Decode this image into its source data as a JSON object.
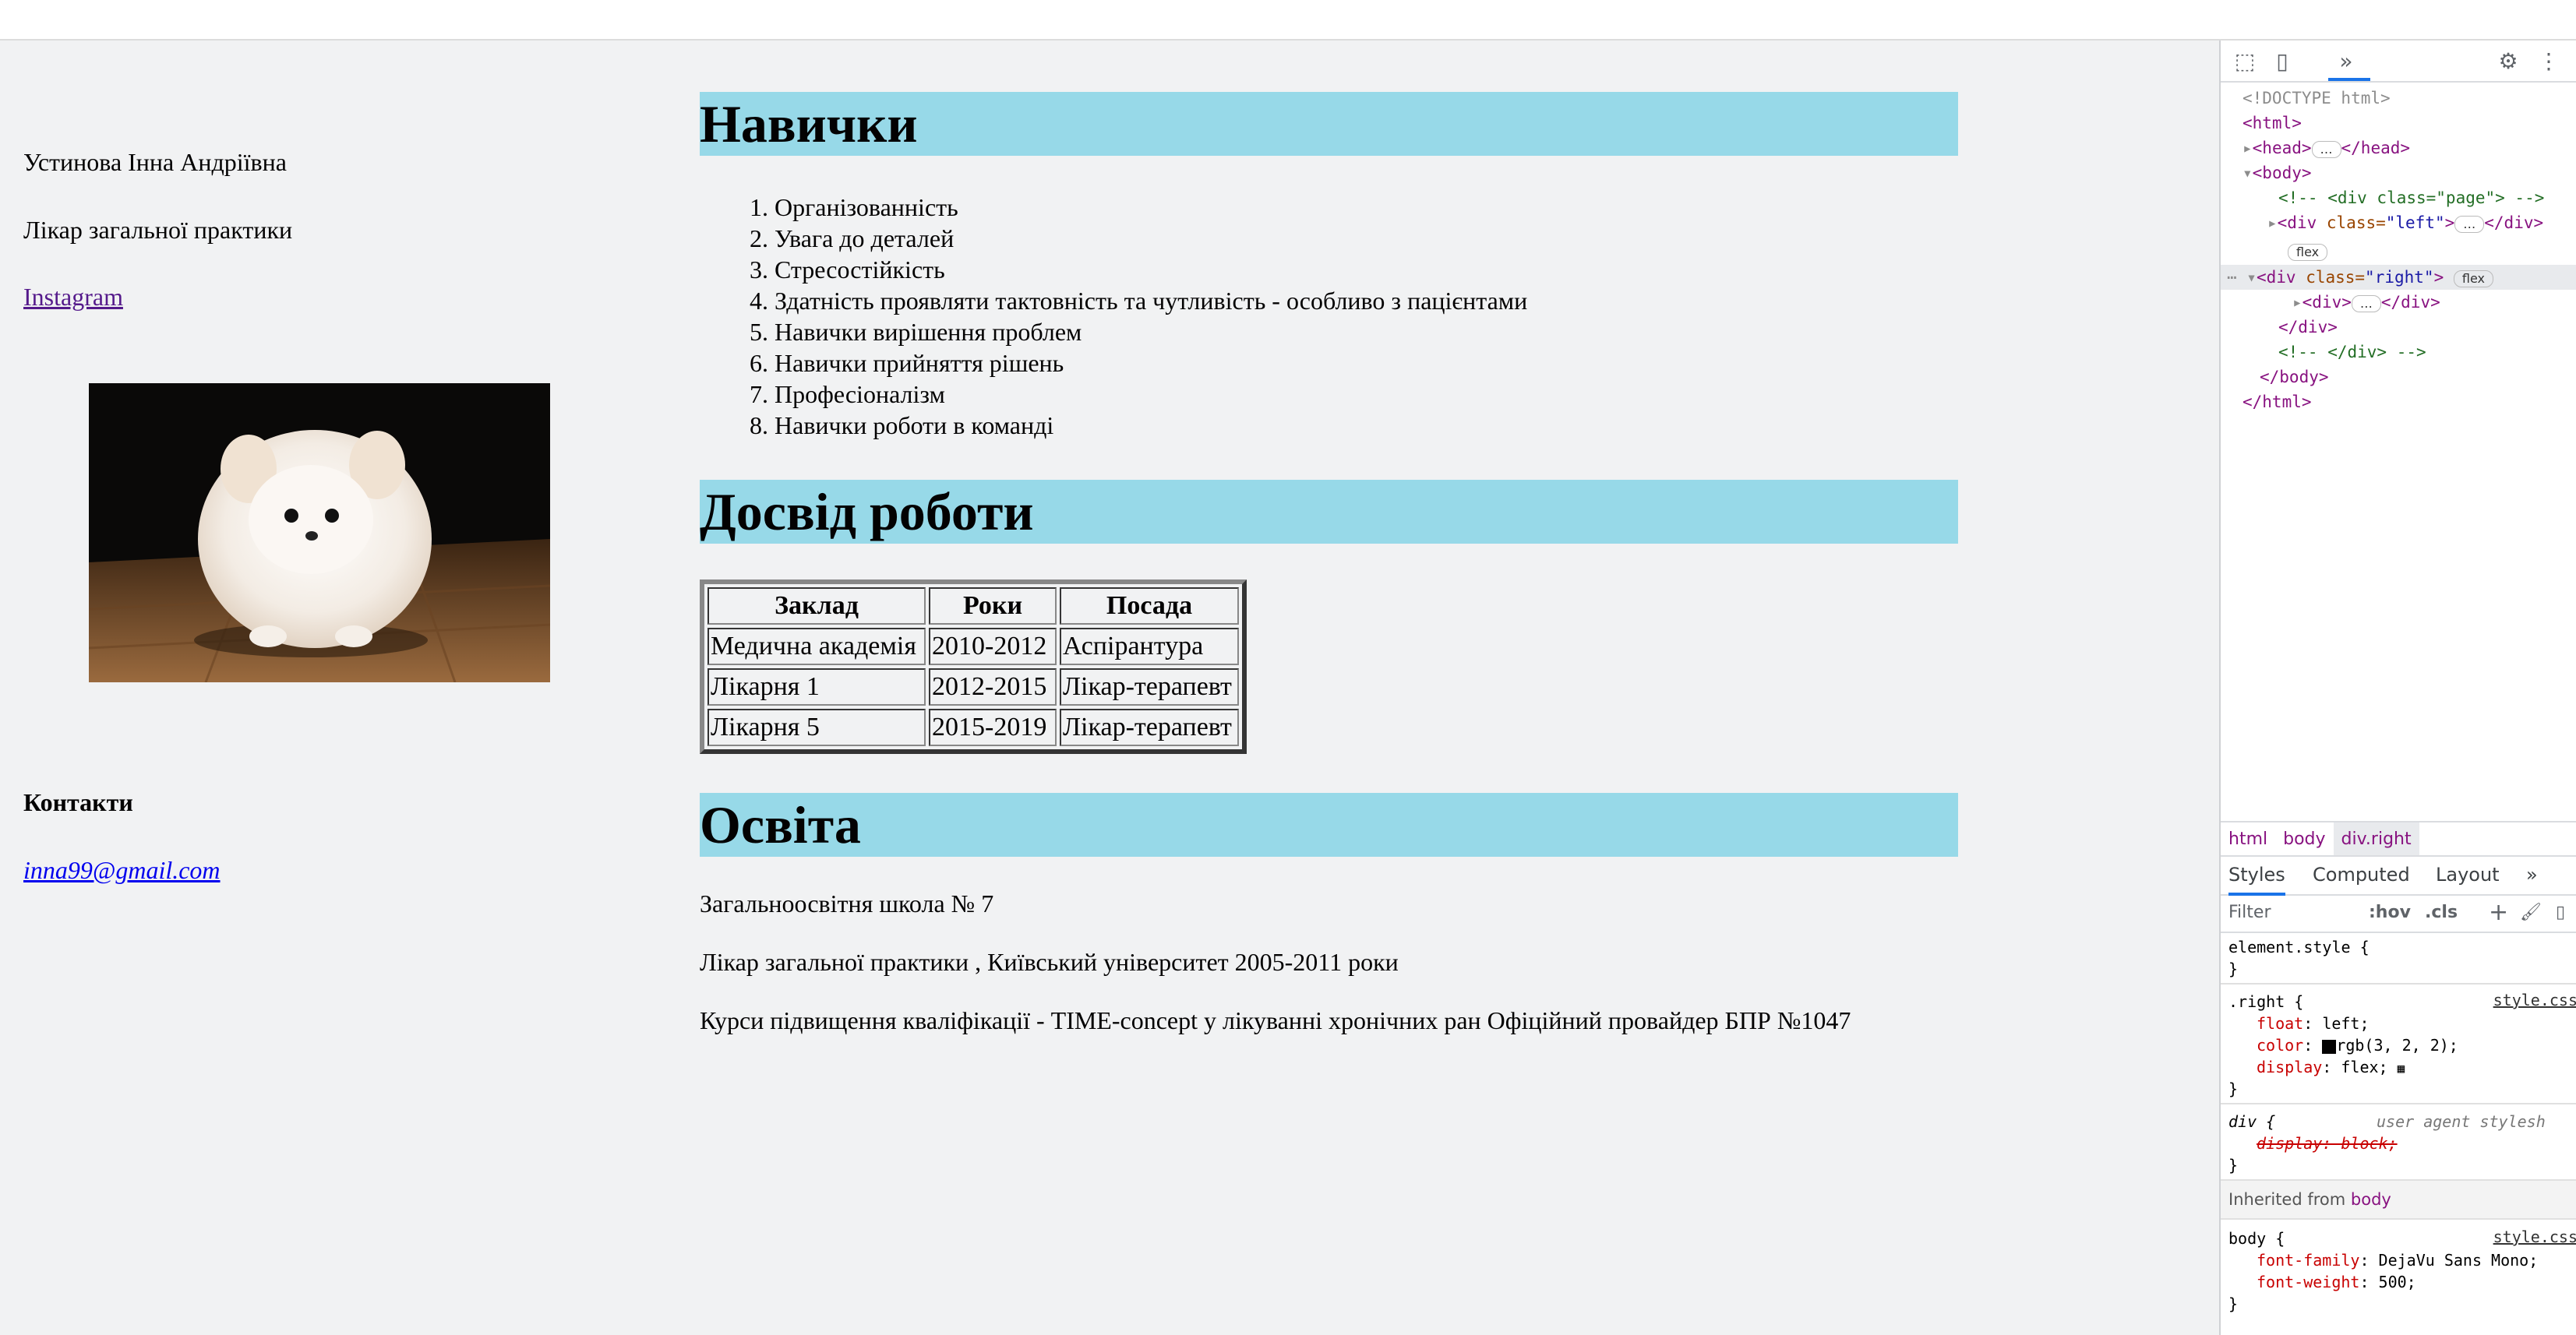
{
  "left": {
    "name": "Устинова Інна Андріївна",
    "role": "Лікар загальної практики",
    "instagram": "Instagram",
    "photo_alt": "white pomeranian puppy photo",
    "contacts_heading": "Контакти",
    "email": "inna99@gmail.com"
  },
  "skills": {
    "heading": "Навички",
    "items": [
      {
        "num": "1.",
        "text": "Організованність"
      },
      {
        "num": "2.",
        "text": "Увага до деталей"
      },
      {
        "num": "3.",
        "text": "Стресостійкість"
      },
      {
        "num": "4.",
        "text": "Здатність проявляти тактовність та чутливість - особливо з пацієнтами"
      },
      {
        "num": "5.",
        "text": "Навички вирішення проблем"
      },
      {
        "num": "6.",
        "text": "Навички прийняття рішень"
      },
      {
        "num": "7.",
        "text": "Професіоналізм"
      },
      {
        "num": "8.",
        "text": "Навички роботи в команді"
      }
    ]
  },
  "experience": {
    "heading": "Досвід роботи",
    "columns": [
      "Заклад",
      "Роки",
      "Посада"
    ],
    "rows": [
      [
        "Медична академія",
        "2010-2012",
        "Аспірантура"
      ],
      [
        "Лікарня 1",
        "2012-2015",
        "Лікар-терапевт"
      ],
      [
        "Лікарня 5",
        "2015-2019",
        "Лікар-терапевт"
      ]
    ]
  },
  "education": {
    "heading": "Освіта",
    "lines": [
      "Загальноосвітня школа № 7",
      "Лікар загальної практики , Київський університет 2005-2011 роки",
      "Курси підвищення кваліфікації - TIME-concept у лікуванні хронічних ран Офіційний провайдер БПР №1047"
    ]
  },
  "devtools": {
    "dom": {
      "doctype": "<!DOCTYPE html>",
      "html_open": "<html>",
      "head": "<head>",
      "head_close": "</head>",
      "body_open": "<body>",
      "comment_page": "<!-- <div class=\"page\"> -->",
      "div_left_tag": "<div",
      "div_left_attr": "class=",
      "div_left_val": "\"left\"",
      "div_left_close": "</div>",
      "flex_badge": "flex",
      "div_right_val": "\"right\"",
      "inner_div": "<div>",
      "inner_div_close": "</div>",
      "div_close": "</div>",
      "comment_close": "<!-- </div> -->",
      "body_close": "</body>",
      "html_close": "</html>",
      "ellipsis": "…"
    },
    "breadcrumbs": [
      "html",
      "body",
      "div.right"
    ],
    "tabs": [
      "Styles",
      "Computed",
      "Layout"
    ],
    "filter_placeholder": "Filter",
    "hov": ":hov",
    ".cls": ".cls",
    "rules": {
      "element_style": "element.style {",
      "close": "}",
      "right_selector": ".right {",
      "right_src": "style.css",
      "float": "float",
      "float_val": "left;",
      "color": "color",
      "color_val": "rgb(3, 2, 2);",
      "swatch_color": "#030202",
      "display": "display",
      "display_val": "flex;",
      "div_selector": "div {",
      "ua_label": "user agent stylesh",
      "ua_display": "display: block;",
      "inherited_label": "Inherited from",
      "inherited_from": "body",
      "body_selector": "body {",
      "body_src": "style.css",
      "font_family": "font-family",
      "font_family_val": "DejaVu Sans Mono;",
      "font_weight": "font-weight",
      "font_weight_val": "500;"
    }
  },
  "colors": {
    "heading_bg": "#97d9e8",
    "page_bg": "#f1f2f3",
    "link_visited": "#551a8b",
    "link": "#0000ee"
  }
}
